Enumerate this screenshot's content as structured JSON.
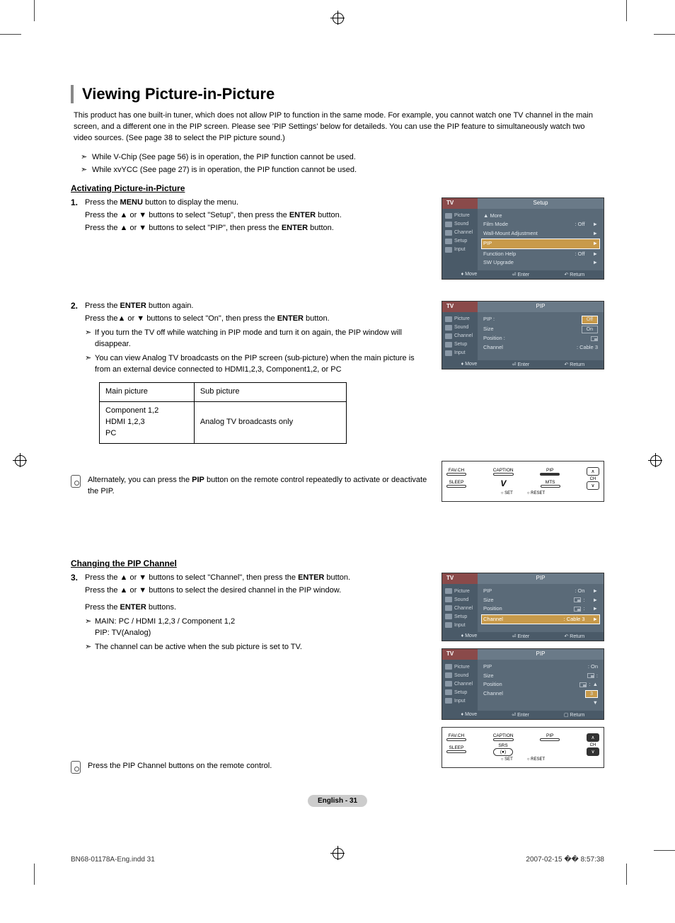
{
  "title": "Viewing Picture-in-Picture",
  "intro": "This product has one built-in tuner, which does not allow PIP to function in the same mode. For example, you cannot watch one TV channel in the main screen, and a different one in the PIP screen. Please see 'PIP Settings' below for detaileds. You can use the PIP feature to simultaneously watch two video sources. (See page 38 to select the PIP picture sound.)",
  "global_notes": [
    "While V-Chip (See page 56) is in operation, the PIP function cannot be used.",
    "While xvYCC (See page 27) is in operation, the PIP function cannot be used."
  ],
  "section_a": {
    "heading": "Activating Picture-in-Picture",
    "step1": {
      "num": "1.",
      "line1a": "Press the ",
      "line1b": "MENU",
      "line1c": " button to display the menu.",
      "line2a": "Press the ▲ or ▼ buttons to select \"Setup\", then press the ",
      "line2b": "ENTER",
      "line2c": " button.",
      "line3a": "Press the ▲ or ▼ buttons to select \"PIP\", then press the ",
      "line3b": "ENTER",
      "line3c": " button."
    },
    "step2": {
      "num": "2.",
      "line1a": "Press the ",
      "line1b": "ENTER",
      "line1c": " button again.",
      "line2a": "Press the▲ or ▼ buttons to select \"On\", then press the ",
      "line2b": "ENTER",
      "line2c": " button.",
      "note1": "If you turn the TV off while watching in PIP mode and turn it on again, the PIP window will disappear.",
      "note2": "You can view Analog TV broadcasts on the PIP screen (sub-picture) when the main picture is from an external device connected to HDMI1,2,3, Component1,2, or PC"
    },
    "table": {
      "h1": "Main picture",
      "h2": "Sub picture",
      "c1": "Component 1,2\nHDMI 1,2,3\nPC",
      "c2": "Analog TV broadcasts only"
    },
    "alt_note_a": "Alternately, you can press the ",
    "alt_note_b": "PIP",
    "alt_note_c": " button on the remote control repeatedly to activate or deactivate the PIP."
  },
  "section_b": {
    "heading": "Changing the PIP Channel",
    "step3": {
      "num": "3.",
      "line1a": "Press the ▲ or ▼ buttons to select \"Channel\", then press the ",
      "line1b": "ENTER",
      "line1c": " button.",
      "line2": "Press the ▲ or ▼ buttons to select the desired channel in the PIP window.",
      "line3a": "Press the ",
      "line3b": "ENTER",
      "line3c": " buttons.",
      "note1": "MAIN: PC / HDMI 1,2,3 / Component 1,2\nPIP: TV(Analog)",
      "note2": "The channel can be active when the sub picture is set to TV."
    },
    "alt_note": "Press the PIP Channel buttons on the remote control."
  },
  "osd": {
    "tv": "TV",
    "side": {
      "picture": "Picture",
      "sound": "Sound",
      "channel": "Channel",
      "setup": "Setup",
      "input": "Input"
    },
    "foot": {
      "move": "Move",
      "enter": "Enter",
      "return": "Return"
    },
    "panel1": {
      "title": "Setup",
      "rows": [
        {
          "label": "▲ More",
          "val": ""
        },
        {
          "label": "Film Mode",
          "val": ": Off",
          "arr": "►"
        },
        {
          "label": "Wall-Mount Adjustment",
          "val": "",
          "arr": "►"
        },
        {
          "label": "PIP",
          "val": "",
          "arr": "►",
          "hl": true
        },
        {
          "label": "Function Help",
          "val": ": Off",
          "arr": "►"
        },
        {
          "label": "SW Upgrade",
          "val": "",
          "arr": "►"
        }
      ]
    },
    "panel2": {
      "title": "PIP",
      "rows": [
        {
          "label": "PIP",
          "val": "Off",
          "boxhl": true,
          "colon": ":"
        },
        {
          "label": "Size",
          "val": "On",
          "box": true,
          "colon": ""
        },
        {
          "label": "Position",
          "val": "",
          "icon": true,
          "colon": ":"
        },
        {
          "label": "Channel",
          "val": ": Cable 3"
        }
      ]
    },
    "panel3": {
      "title": "PIP",
      "rows": [
        {
          "label": "PIP",
          "val": ": On",
          "arr": "►"
        },
        {
          "label": "Size",
          "val": ":",
          "icon": true,
          "arr": "►"
        },
        {
          "label": "Position",
          "val": ":",
          "icon": true,
          "arr": "►"
        },
        {
          "label": "Channel",
          "val": ": Cable 3",
          "arr": "►",
          "hl": true
        }
      ]
    },
    "panel4": {
      "title": "PIP",
      "rows": [
        {
          "label": "PIP",
          "val": ": On"
        },
        {
          "label": "Size",
          "val": ":",
          "icon": true
        },
        {
          "label": "Position",
          "val": ":",
          "icon": true,
          "updown": "▲"
        },
        {
          "label": "Channel",
          "val": "3",
          "box": true,
          "boxhl": true
        },
        {
          "label": "",
          "val": "",
          "updown": "▼"
        }
      ]
    }
  },
  "remote": {
    "favch": "FAV.CH",
    "caption": "CAPTION",
    "pip": "PIP",
    "sleep": "SLEEP",
    "mts": "MTS",
    "srs": "SRS",
    "ch": "CH",
    "set": "SET",
    "reset": "RESET",
    "up": "∧",
    "down": "∨"
  },
  "page_footer": "English - 31",
  "doc_footer_left": "BN68-01178A-Eng.indd   31",
  "doc_footer_right": "2007-02-15   �� 8:57:38"
}
